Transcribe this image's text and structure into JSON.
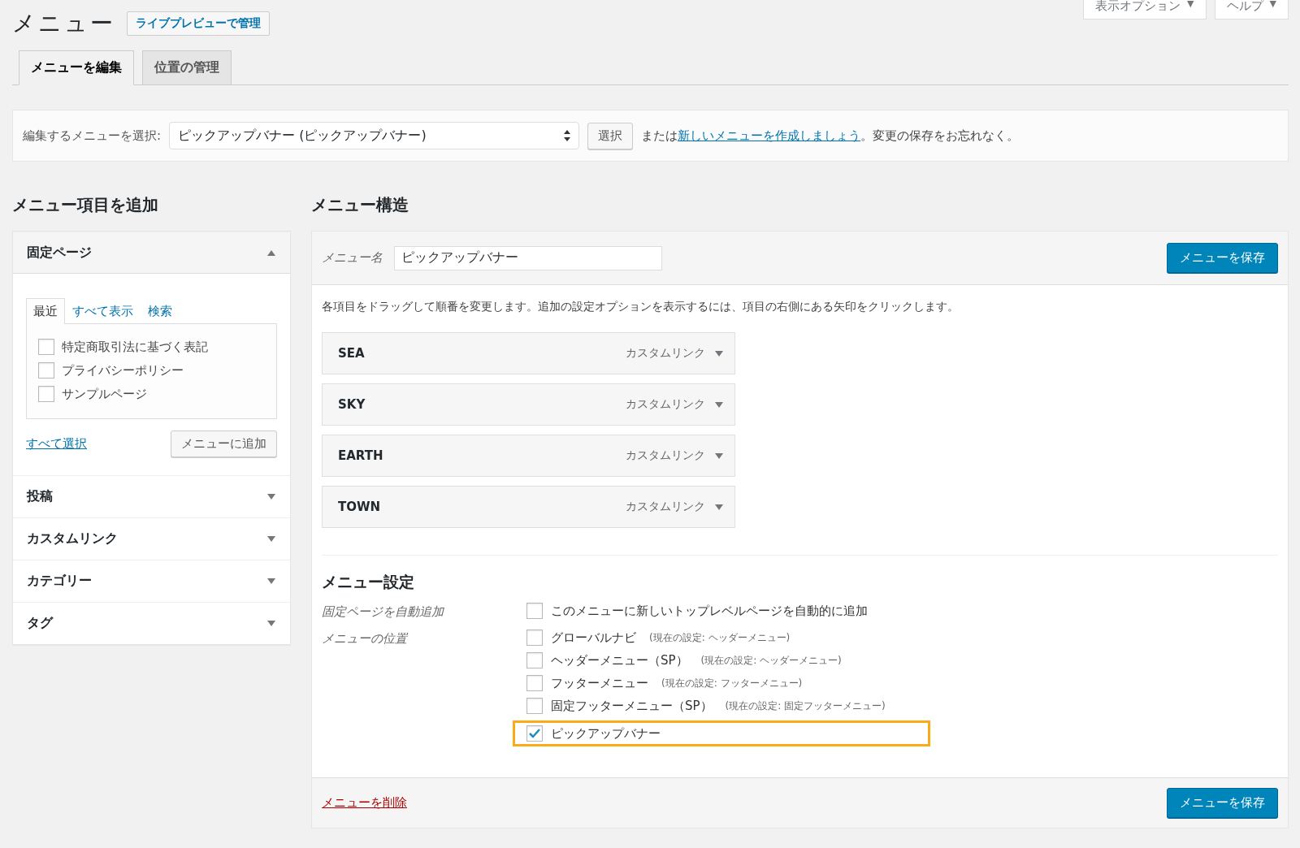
{
  "title": "メニュー",
  "live_preview_button": "ライブプレビューで管理",
  "top_buttons": [
    {
      "label": "表示オプション",
      "arrow": "▼"
    },
    {
      "label": "ヘルプ",
      "arrow": "▼"
    }
  ],
  "tabs": [
    {
      "label": "メニューを編集",
      "selected": true
    },
    {
      "label": "位置の管理",
      "selected": false
    }
  ],
  "menu_select": {
    "label": "編集するメニューを選択:",
    "value": "ピックアップバナー (ピックアップバナー)",
    "select_button": "選択",
    "before_link": "または",
    "create_link": "新しいメニューを作成しましょう",
    "after_link": "。変更の保存をお忘れなく。"
  },
  "add_items": {
    "heading": "メニュー項目を追加",
    "panels": [
      {
        "title": "固定ページ",
        "expanded": true,
        "subtabs": [
          {
            "label": "最近",
            "selected": true
          },
          {
            "label": "すべて表示",
            "selected": false
          },
          {
            "label": "検索",
            "selected": false
          }
        ],
        "items": [
          {
            "label": "特定商取引法に基づく表記",
            "checked": false
          },
          {
            "label": "プライバシーポリシー",
            "checked": false
          },
          {
            "label": "サンプルページ",
            "checked": false
          }
        ],
        "select_all": "すべて選択",
        "add_button": "メニューに追加"
      },
      {
        "title": "投稿",
        "expanded": false
      },
      {
        "title": "カスタムリンク",
        "expanded": false
      },
      {
        "title": "カテゴリー",
        "expanded": false
      },
      {
        "title": "タグ",
        "expanded": false
      }
    ]
  },
  "structure": {
    "heading": "メニュー構造",
    "name_label": "メニュー名",
    "name_value": "ピックアップバナー",
    "save_button": "メニューを保存",
    "instructions": "各項目をドラッグして順番を変更します。追加の設定オプションを表示するには、項目の右側にある矢印をクリックします。",
    "items": [
      {
        "title": "SEA",
        "type": "カスタムリンク"
      },
      {
        "title": "SKY",
        "type": "カスタムリンク"
      },
      {
        "title": "EARTH",
        "type": "カスタムリンク"
      },
      {
        "title": "TOWN",
        "type": "カスタムリンク"
      }
    ],
    "settings": {
      "heading": "メニュー設定",
      "rows": [
        {
          "label": "固定ページを自動追加",
          "options": [
            {
              "label": "このメニューに新しいトップレベルページを自動的に追加",
              "checked": false,
              "highlighted": false
            }
          ]
        },
        {
          "label": "メニューの位置",
          "options": [
            {
              "label": "グローバルナビ",
              "note": "(現在の設定: ヘッダーメニュー)",
              "checked": false,
              "highlighted": false
            },
            {
              "label": "ヘッダーメニュー（SP）",
              "note": "(現在の設定: ヘッダーメニュー)",
              "checked": false,
              "highlighted": false
            },
            {
              "label": "フッターメニュー",
              "note": "(現在の設定: フッターメニュー)",
              "checked": false,
              "highlighted": false
            },
            {
              "label": "固定フッターメニュー（SP）",
              "note": "(現在の設定: 固定フッターメニュー)",
              "checked": false,
              "highlighted": false
            },
            {
              "label": "ピックアップバナー",
              "checked": true,
              "highlighted": true
            }
          ]
        }
      ]
    },
    "delete_link": "メニューを削除",
    "footer_save_button": "メニューを保存"
  }
}
